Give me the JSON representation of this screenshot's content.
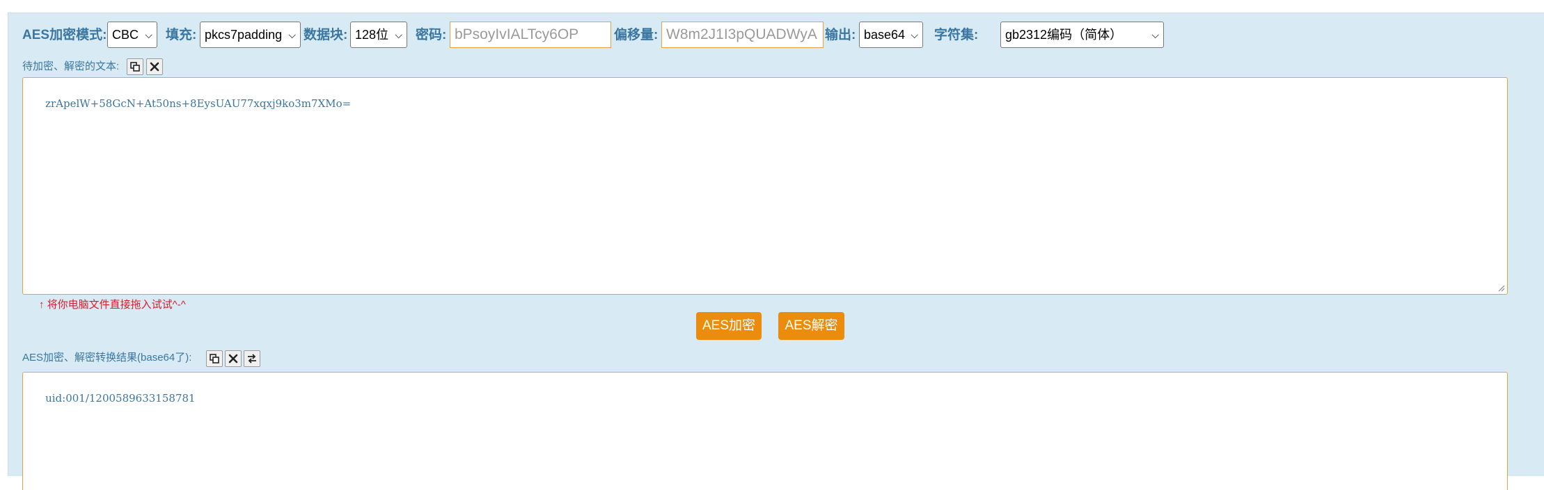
{
  "toolbar": {
    "mode_label": "AES加密模式:",
    "mode_value": "CBC",
    "padding_label": "填充:",
    "padding_value": "pkcs7padding",
    "block_label": "数据块:",
    "block_value": "128位",
    "password_label": "密码:",
    "password_placeholder": "bPsoyIvIALTcy6OP",
    "offset_label": "偏移量:",
    "offset_placeholder": "W8m2J1I3pQUADWyA",
    "output_label": "输出:",
    "output_value": "base64",
    "charset_label": "字符集:",
    "charset_value": "gb2312编码（简体）"
  },
  "input_section": {
    "label": "待加密、解密的文本:",
    "text": "zrApelW+58GcN+At50ns+8EysUAU77xqxj9ko3m7XMo=",
    "hint": "↑ 将你电脑文件直接拖入试试^-^"
  },
  "actions": {
    "encrypt_label": "AES加密",
    "decrypt_label": "AES解密"
  },
  "output_section": {
    "label": "AES加密、解密转换结果(base64了):",
    "text": "uid:001/1200589633158781"
  },
  "colors": {
    "panel_bg": "#d8ebf4",
    "label_blue": "#3a76a0",
    "accent_orange": "#ec8c0c",
    "hint_red": "#e0182a"
  }
}
